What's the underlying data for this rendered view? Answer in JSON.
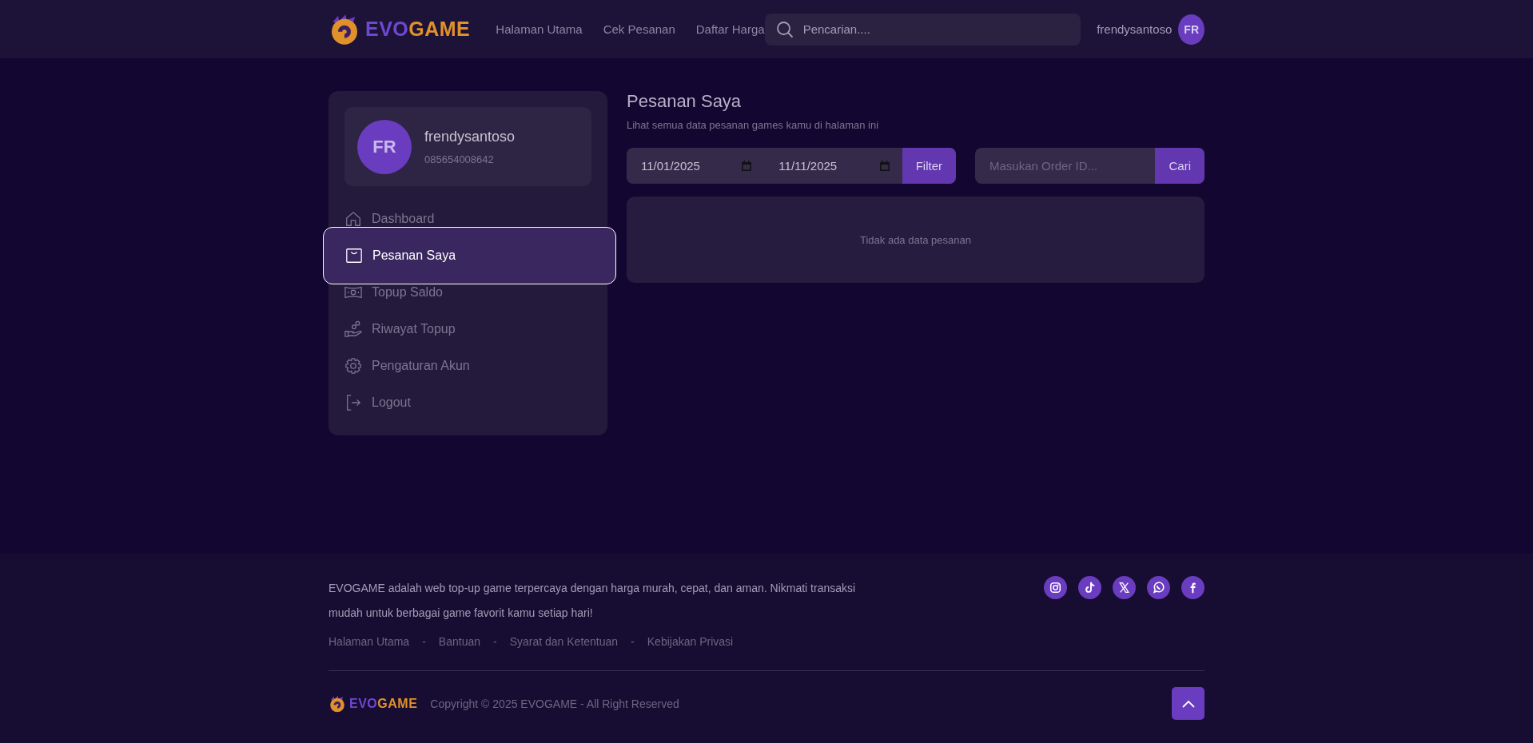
{
  "header": {
    "logo": {
      "primary": "EVO",
      "accent": "GAME"
    },
    "nav": [
      "Halaman Utama",
      "Cek Pesanan",
      "Daftar Harga"
    ],
    "search": {
      "placeholder": "Pencarian...."
    },
    "username": "frendysantoso",
    "avatar_initials": "FR"
  },
  "sidebar": {
    "profile": {
      "initials": "FR",
      "name": "frendysantoso",
      "phone": "085654008642"
    },
    "items": [
      {
        "kind": "home",
        "label": "Dashboard",
        "selected": false
      },
      {
        "kind": "bag",
        "label": "Pesanan Saya",
        "selected": true
      },
      {
        "kind": "money",
        "label": "Topup Saldo",
        "selected": false
      },
      {
        "kind": "hand",
        "label": "Riwayat Topup",
        "selected": false
      },
      {
        "kind": "gear",
        "label": "Pengaturan Akun",
        "selected": false
      },
      {
        "kind": "logout",
        "label": "Logout",
        "selected": false
      }
    ]
  },
  "main": {
    "title": "Pesanan Saya",
    "subtitle": "Lihat semua data pesanan games kamu di halaman ini",
    "date_from": "11/01/2025",
    "date_to": "11/11/2025",
    "filter_button": "Filter",
    "order_search": {
      "placeholder": "Masukan Order ID..."
    },
    "search_button": "Cari",
    "empty_message": "Tidak ada data pesanan"
  },
  "footer": {
    "description": "EVOGAME adalah web top-up game terpercaya dengan harga murah, cepat, dan aman. Nikmati transaksi mudah untuk berbagai game favorit kamu setiap hari!",
    "socials": [
      {
        "kind": "instagram"
      },
      {
        "kind": "tiktok"
      },
      {
        "kind": "x"
      },
      {
        "kind": "whatsapp"
      },
      {
        "kind": "facebook"
      }
    ],
    "links": [
      "Halaman Utama",
      "Bantuan",
      "Syarat dan Ketentuan",
      "Kebijakan Privasi"
    ],
    "link_separators": [
      "-",
      "-",
      "-"
    ],
    "logo": {
      "primary": "EVO",
      "accent": "GAME"
    },
    "copyright": "Copyright © 2025 EVOGAME - All Right Reserved"
  }
}
